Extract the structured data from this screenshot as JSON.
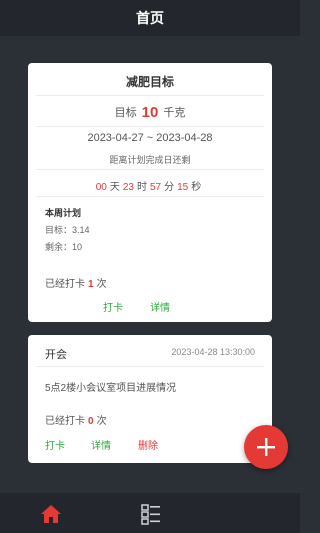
{
  "header": {
    "title": "首页"
  },
  "goal_card": {
    "title": "减肥目标",
    "target_label": "目标",
    "target_value": "10",
    "target_unit": "千克",
    "date_range": "2023-04-27 ~ 2023-04-28",
    "countdown_label": "距离计划完成日还剩",
    "countdown": {
      "days": "00",
      "days_unit": "天",
      "hours": "23",
      "hours_unit": "时",
      "minutes": "57",
      "minutes_unit": "分",
      "seconds": "15",
      "seconds_unit": "秒"
    },
    "week_plan_title": "本周计划",
    "week_target": "目标：3.14",
    "week_remaining": "剩余：10",
    "checkin_prefix": "已经打卡",
    "checkin_count": "1",
    "checkin_suffix": "次",
    "checkin_button": "打卡",
    "detail_button": "详情",
    "accent_color": "#e53935",
    "action_color": "#2eaa3e"
  },
  "meeting_card": {
    "title": "开会",
    "datetime": "2023-04-28 13:30:00",
    "description": "5点2楼小会议室项目进展情况",
    "checkin_prefix": "已经打卡",
    "checkin_count": "0",
    "checkin_suffix": "次",
    "checkin_button": "打卡",
    "detail_button": "详情",
    "delete_button": "删除"
  },
  "fab": {
    "icon": "plus-icon",
    "color": "#e53935"
  },
  "tabbar": {
    "items": [
      {
        "icon": "home-icon",
        "active": true,
        "color": "#e53935"
      },
      {
        "icon": "list-icon",
        "active": false,
        "color": "#cfd3d8"
      }
    ]
  }
}
